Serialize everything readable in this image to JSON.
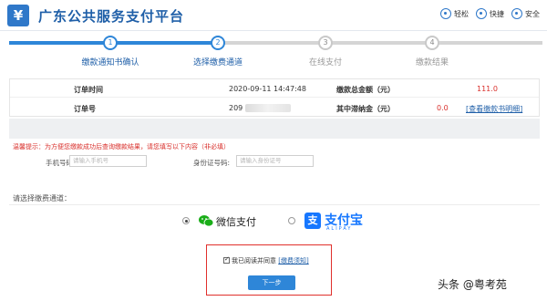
{
  "header": {
    "logo_glyph": "¥",
    "title": "广东公共服务支付平台",
    "links": [
      {
        "label": "轻松",
        "icon": "easy-icon"
      },
      {
        "label": "快捷",
        "icon": "fast-icon"
      },
      {
        "label": "安全",
        "icon": "secure-icon"
      }
    ]
  },
  "steps": [
    {
      "number": "1",
      "label": "缴款通知书确认",
      "active": true
    },
    {
      "number": "2",
      "label": "选择缴费通道",
      "active": true
    },
    {
      "number": "3",
      "label": "在线支付",
      "active": false
    },
    {
      "number": "4",
      "label": "缴款结果",
      "active": false
    }
  ],
  "order": {
    "time_label": "订单时间",
    "time_value": "2020-09-11 14:47:48",
    "total_label": "缴款总金额（元）",
    "total_value": "111.0",
    "number_label": "订单号",
    "number_value": "209",
    "fee_label": "其中滞纳金（元）",
    "fee_value": "0.0",
    "detail_link": "[查看缴款书明细]"
  },
  "form": {
    "notice": "温馨提示：为方便您缴款成功后查询缴款结果，请您填写以下内容（非必填）",
    "phone_label": "手机号码:",
    "phone_placeholder": "请输入手机号",
    "id_label": "身份证号码:",
    "id_placeholder": "请输入身份证号"
  },
  "channel": {
    "label": "请选择缴费通道：",
    "options": [
      {
        "name": "微信支付",
        "checked": true
      },
      {
        "name": "支付宝",
        "sub": "ALIPAY",
        "checked": false
      }
    ]
  },
  "agreement": {
    "text": "我已阅读并同意",
    "link": "[缴费须知]",
    "button": "下一步"
  },
  "watermark": "头条 @粤考苑",
  "colors": {
    "accent": "#2e86d8",
    "brand": "#1f5fa8",
    "alert": "#d9302c",
    "alipay": "#1677ff"
  }
}
